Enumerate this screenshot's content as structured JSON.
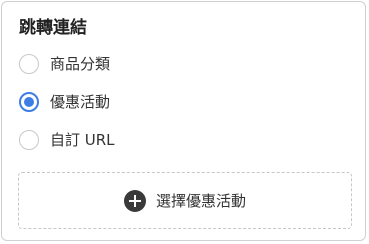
{
  "panel": {
    "title": "跳轉連結"
  },
  "radio_options": [
    {
      "label": "商品分類",
      "checked": false
    },
    {
      "label": "優惠活動",
      "checked": true
    },
    {
      "label": "自訂 URL",
      "checked": false
    }
  ],
  "add_button": {
    "label": "選擇優惠活動",
    "icon": "plus-circle-icon"
  },
  "colors": {
    "accent": "#3d7ee6",
    "text": "#333333",
    "title": "#222222",
    "border": "#d0d0d0",
    "dashed_border": "#c7c7c7",
    "icon_fill": "#3a3a3a"
  }
}
